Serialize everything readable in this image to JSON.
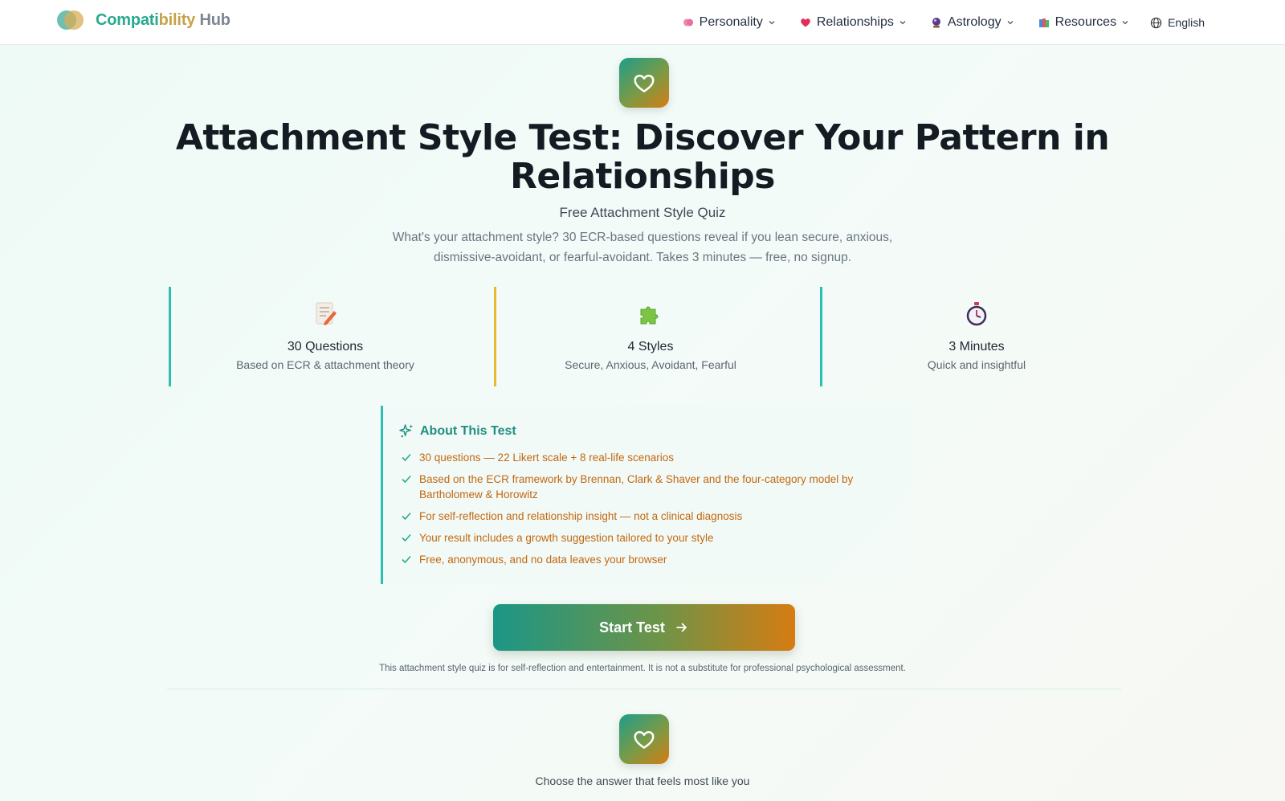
{
  "header": {
    "logo": {
      "part1": "Compati",
      "part2": "bility",
      "part3": " Hub"
    },
    "nav": [
      {
        "label": "Personality",
        "icon": "brain-icon"
      },
      {
        "label": "Relationships",
        "icon": "heart-icon"
      },
      {
        "label": "Astrology",
        "icon": "crystal-ball-icon"
      },
      {
        "label": "Resources",
        "icon": "books-icon"
      }
    ],
    "language": "English"
  },
  "hero": {
    "title": "Attachment Style Test: Discover Your Pattern in Relationships",
    "subtitle": "Free Attachment Style Quiz",
    "description": "What's your attachment style? 30 ECR-based questions reveal if you lean secure, anxious, dismissive-avoidant, or fearful-avoidant. Takes 3 minutes — free, no signup."
  },
  "stats": [
    {
      "icon": "memo-icon",
      "label": "30 Questions",
      "sub": "Based on ECR & attachment theory",
      "color": "#2abfb0"
    },
    {
      "icon": "puzzle-icon",
      "label": "4 Styles",
      "sub": "Secure, Anxious, Avoidant, Fearful",
      "color": "#e8b830"
    },
    {
      "icon": "stopwatch-icon",
      "label": "3 Minutes",
      "sub": "Quick and insightful",
      "color": "#2abfb0"
    }
  ],
  "about": {
    "title": "About This Test",
    "items": [
      "30 questions — 22 Likert scale + 8 real-life scenarios",
      "Based on the ECR framework by Brennan, Clark & Shaver and the four-category model by Bartholomew & Horowitz",
      "For self-reflection and relationship insight — not a clinical diagnosis",
      "Your result includes a growth suggestion tailored to your style",
      "Free, anonymous, and no data leaves your browser"
    ]
  },
  "cta": {
    "label": "Start Test"
  },
  "disclaimer": "This attachment style quiz is for self-reflection and entertainment. It is not a substitute for professional psychological assessment.",
  "question_hint": "Choose the answer that feels most like you",
  "colors": {
    "accent_teal": "#1e9d8c",
    "accent_orange": "#d67c12",
    "list_text": "#c2680f"
  }
}
